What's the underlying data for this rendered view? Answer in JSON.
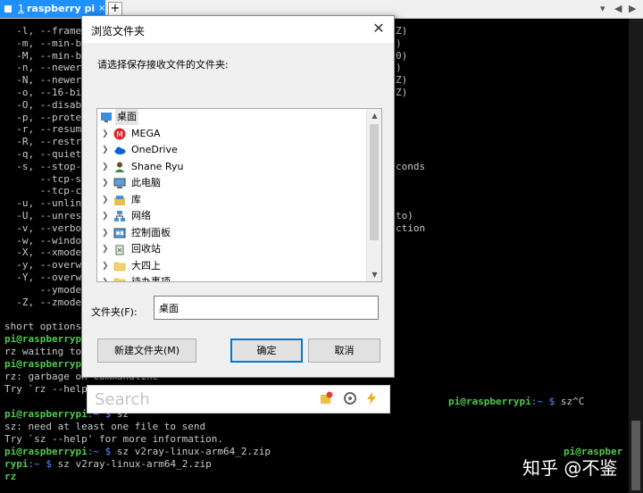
{
  "tab": {
    "number": "1",
    "title": "raspberry pi",
    "close": "×",
    "add": "+"
  },
  "window_controls": {
    "menu": "▾",
    "left": "◀",
    "right": "▶"
  },
  "terminal": {
    "lines": [
      {
        "t": "  -l, --frame",
        "r": "Z)"
      },
      {
        "t": "  -m, --min-b",
        "r": ")"
      },
      {
        "t": "  -M, --min-b",
        "r": "0)"
      },
      {
        "t": "  -n, --newer",
        "r": ")"
      },
      {
        "t": "  -N, --newer",
        "r": "Z)"
      },
      {
        "t": "  -o, --16-bi",
        "r": "Z)"
      },
      {
        "t": "  -O, --disab",
        "r": ""
      },
      {
        "t": "  -p, --prote",
        "r": ""
      },
      {
        "t": "  -r, --resum",
        "r": ""
      },
      {
        "t": "  -R, --restr",
        "r": ""
      },
      {
        "t": "  -q, --quiet",
        "r": ""
      },
      {
        "t": "  -s, --stop-",
        "r": "conds"
      },
      {
        "t": "      --tcp-s",
        "r": ""
      },
      {
        "t": "      --tcp-c",
        "r": ""
      },
      {
        "t": "  -u, --unlin",
        "r": ""
      },
      {
        "t": "  -U, --unres",
        "r": "to)"
      },
      {
        "t": "  -v, --verbo",
        "r": "ction"
      },
      {
        "t": "  -w, --windo",
        "r": ""
      },
      {
        "t": "  -X, --xmode",
        "r": ""
      },
      {
        "t": "  -y, --overw",
        "r": ""
      },
      {
        "t": "  -Y, --overw",
        "r": ""
      },
      {
        "t": "      --ymode",
        "r": ""
      },
      {
        "t": "  -Z, --zmode",
        "r": ""
      }
    ],
    "short_options": "short options",
    "prompt_user": "pi@raspberrypi",
    "prompt_path": ":~ $",
    "rz_waiting": "rz waiting to",
    "prompt2": "pi@raspberryp",
    "garbage": "rz: garbage on commandline",
    "try_rz": "Try `rz --help",
    "right_prompt": "pi@raspberrypi",
    "right_path": ":~ $",
    "right_cmd": " sz^C",
    "sz_cmd": " sz",
    "sz_need": "sz: need at least one file to send",
    "try_sz": "Try `sz --help' for more information.",
    "sz_file_cmd": " sz v2ray-linux-arm64_2.zip",
    "right_pi": "pi@raspber",
    "cont_user": "rypi",
    "cont_path": ":~ $",
    "cont_cmd": " sz v2ray-linux-arm64_2.zip",
    "last": "rz"
  },
  "watermark": "知乎 @不鉴",
  "search": {
    "placeholder": "Search"
  },
  "dialog": {
    "title": "浏览文件夹",
    "close": "✕",
    "prompt": "请选择保存接收文件的文件夹:",
    "tree": [
      {
        "label": "桌面",
        "root": true,
        "icon": "desktop-icon"
      },
      {
        "label": "MEGA",
        "icon": "mega-icon"
      },
      {
        "label": "OneDrive",
        "icon": "onedrive-icon"
      },
      {
        "label": "Shane Ryu",
        "icon": "user-icon"
      },
      {
        "label": "此电脑",
        "icon": "computer-icon"
      },
      {
        "label": "库",
        "icon": "library-icon"
      },
      {
        "label": "网络",
        "icon": "network-icon"
      },
      {
        "label": "控制面板",
        "icon": "control-panel-icon"
      },
      {
        "label": "回收站",
        "icon": "recycle-bin-icon"
      },
      {
        "label": "大四上",
        "icon": "folder-icon"
      },
      {
        "label": "待办事项",
        "icon": "folder-icon"
      }
    ],
    "folder_label": "文件夹(F):",
    "folder_value": "桌面",
    "new_folder": "新建文件夹(M)",
    "ok": "确定",
    "cancel": "取消"
  }
}
